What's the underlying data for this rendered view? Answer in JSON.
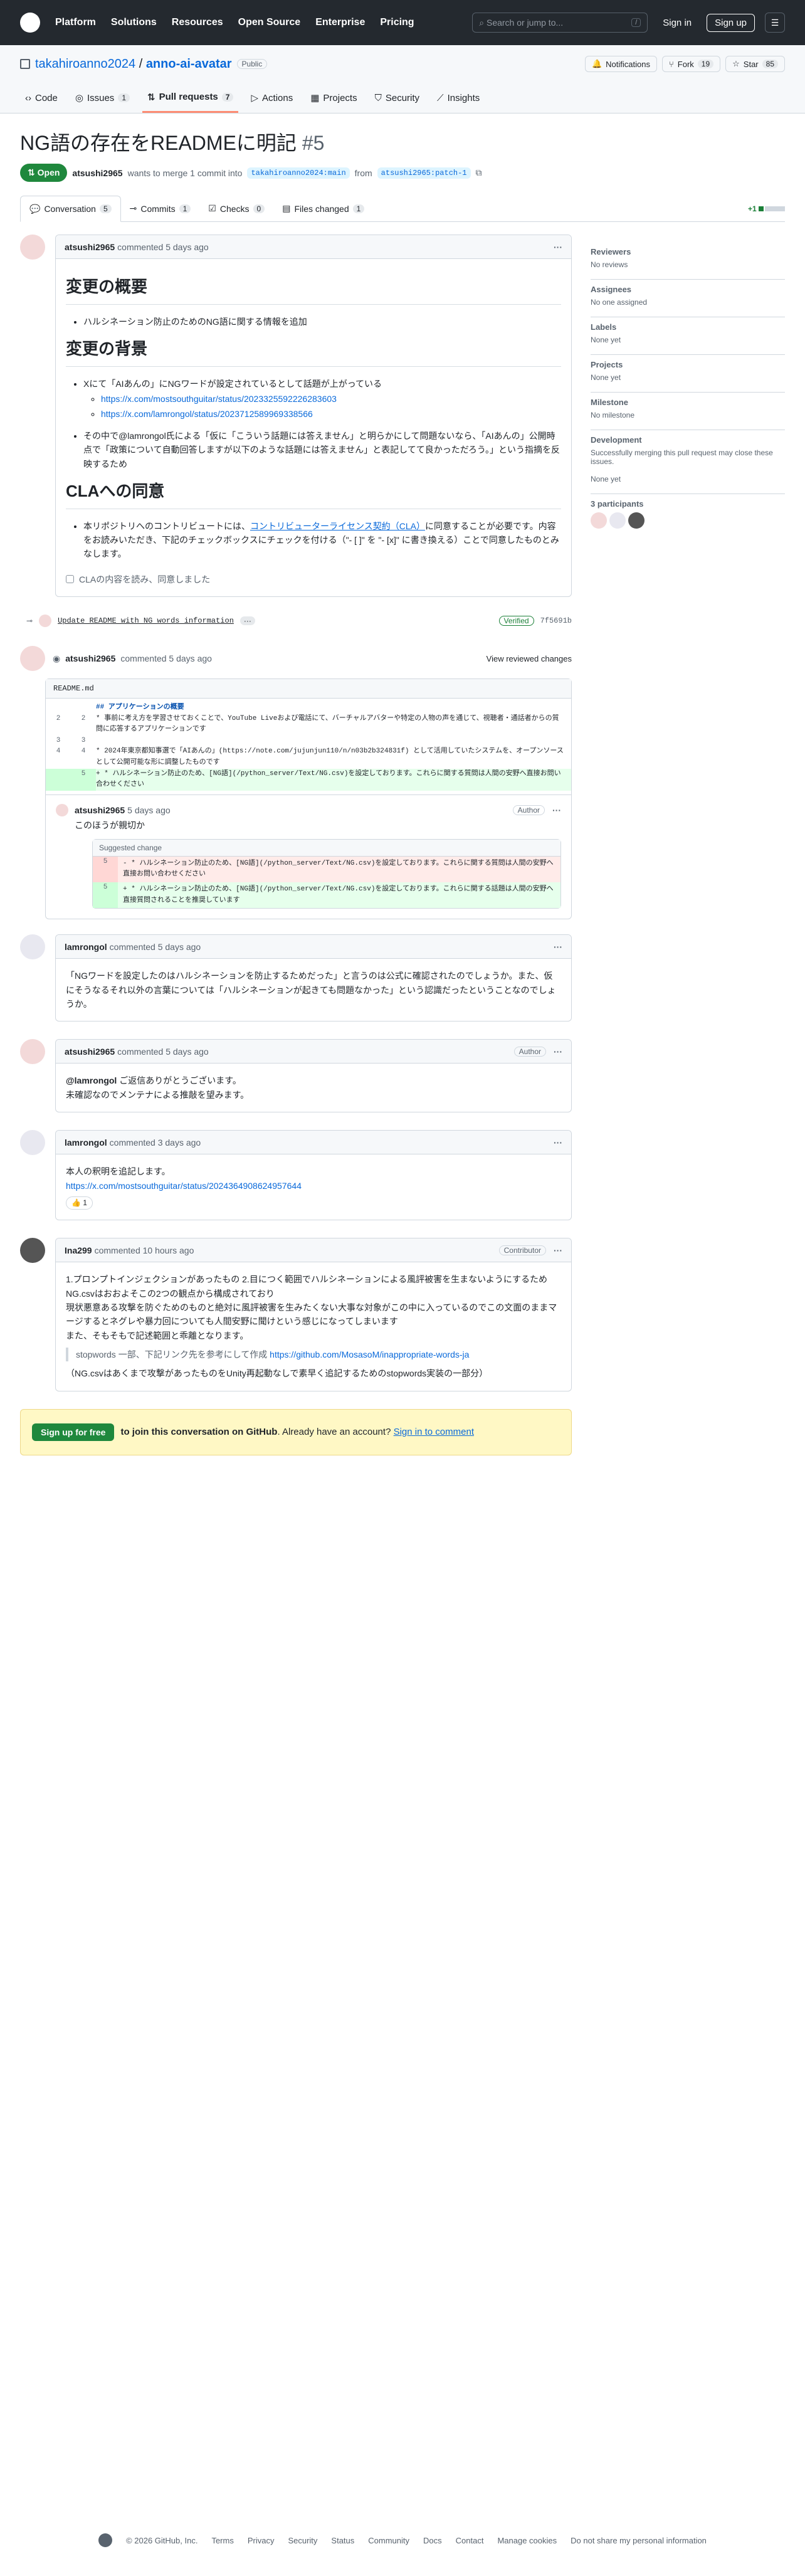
{
  "header": {
    "nav": [
      "Platform",
      "Solutions",
      "Resources",
      "Open Source",
      "Enterprise",
      "Pricing"
    ],
    "search_placeholder": "Search or jump to...",
    "search_key": "/",
    "signin": "Sign in",
    "signup": "Sign up"
  },
  "repo": {
    "owner": "takahiroanno2024",
    "name": "anno-ai-avatar",
    "visibility": "Public",
    "notifications": "Notifications",
    "fork": "Fork",
    "fork_count": "19",
    "star": "Star",
    "star_count": "85",
    "tabs": [
      {
        "label": "Code",
        "count": ""
      },
      {
        "label": "Issues",
        "count": "1"
      },
      {
        "label": "Pull requests",
        "count": "7"
      },
      {
        "label": "Actions",
        "count": ""
      },
      {
        "label": "Projects",
        "count": ""
      },
      {
        "label": "Security",
        "count": ""
      },
      {
        "label": "Insights",
        "count": ""
      }
    ]
  },
  "pr": {
    "title": "NG語の存在をREADMEに明記",
    "number": "#5",
    "state": "Open",
    "author": "atsushi2965",
    "wants": "wants to merge 1 commit into",
    "base": "takahiroanno2024:main",
    "from": "from",
    "head": "atsushi2965:patch-1",
    "tabs": [
      {
        "label": "Conversation",
        "count": "5"
      },
      {
        "label": "Commits",
        "count": "1"
      },
      {
        "label": "Checks",
        "count": "0"
      },
      {
        "label": "Files changed",
        "count": "1"
      }
    ],
    "diffstat": "+1"
  },
  "sidebar": [
    {
      "h": "Reviewers",
      "v": "No reviews"
    },
    {
      "h": "Assignees",
      "v": "No one assigned"
    },
    {
      "h": "Labels",
      "v": "None yet"
    },
    {
      "h": "Projects",
      "v": "None yet"
    },
    {
      "h": "Milestone",
      "v": "No milestone"
    },
    {
      "h": "Development",
      "v": "Successfully merging this pull request may close these issues."
    },
    {
      "h": "",
      "v": "None yet"
    },
    {
      "h": "3 participants",
      "v": ""
    }
  ],
  "c1": {
    "author": "atsushi2965",
    "when": "commented 5 days ago",
    "h_summary": "変更の概要",
    "summary_item": "ハルシネーション防止のためのNG語に関する情報を追加",
    "h_bg": "変更の背景",
    "bg1": "Xにて「AIあんの」にNGワードが設定されているとして話題が上がっている",
    "link1": "https://x.com/mostsouthguitar/status/2023325592226283603",
    "link2": "https://x.com/lamrongol/status/2023712589969338566",
    "bg2": "その中で@lamrongol氏による「仮に「こういう話題には答えません」と明らかにして問題ないなら、「AIあんの」公開時点で「政策について自動回答しますが以下のような話題には答えません」と表記してて良かっただろう。」という指摘を反映するため",
    "h_cla": "CLAへの同意",
    "cla1": "本リポジトリへのコントリビュートには、",
    "cla_link": "コントリビューターライセンス契約（CLA）",
    "cla2": "に同意することが必要です。内容をお読みいただき、下記のチェックボックスにチェックを付ける（\"- [ ]\" を \"- [x]\" に書き換える）ことで同意したものとみなします。",
    "check": "CLAの内容を読み、同意しました"
  },
  "commit": {
    "msg": "Update README with NG words information",
    "verified": "Verified",
    "sha": "7f5691b"
  },
  "review": {
    "author": "atsushi2965",
    "when": "commented 5 days ago",
    "view": "View reviewed changes",
    "file": "README.md",
    "lines": [
      [
        "",
        "",
        "## アプリケーションの概要"
      ],
      [
        "2",
        "2",
        "* 事前に考え方を学習させておくことで、YouTube Liveおよび電話にて、バーチャルアバターや特定の人物の声を通じて、視聴者・通話者からの質問に応答するアプリケーションです"
      ],
      [
        "3",
        "3",
        ""
      ],
      [
        "4",
        "4",
        "* 2024年東京都知事選で「AIあんの」(https://note.com/jujunjun110/n/n03b2b324831f) として活用していたシステムを、オープンソースとして公開可能な形に調整したものです"
      ],
      [
        "",
        "5",
        "+ * ハルシネーション防止のため、[NG語](/python_server/Text/NG.csv)を設定しております。これらに関する質問は人間の安野へ直接お問い合わせください"
      ]
    ],
    "reply_author": "atsushi2965",
    "reply_when": "5 days ago",
    "role": "Author",
    "reply": "このほうが親切か",
    "sug_title": "Suggested change",
    "del": "- * ハルシネーション防止のため、[NG語](/python_server/Text/NG.csv)を設定しております。これらに関する質問は人間の安野へ直接お問い合わせください",
    "add": "+ * ハルシネーション防止のため、[NG語](/python_server/Text/NG.csv)を設定しております。これらに関する話題は人間の安野へ直接質問されることを推奨しています"
  },
  "c2": {
    "author": "lamrongol",
    "when": "commented 5 days ago",
    "text": "「NGワードを設定したのはハルシネーションを防止するためだった」と言うのは公式に確認されたのでしょうか。また、仮にそうなるそれ以外の言葉については「ハルシネーションが起きても問題なかった」という認識だったということなのでしょうか。"
  },
  "c3": {
    "author": "atsushi2965",
    "when": "commented 5 days ago",
    "role": "Author",
    "mention": "@lamrongol",
    "t1": " ご返信ありがとうございます。",
    "t2": "未確認なのでメンテナによる推敲を望みます。"
  },
  "c4": {
    "author": "lamrongol",
    "when": "commented 3 days ago",
    "t1": "本人の釈明を追記します。",
    "link": "https://x.com/mostsouthguitar/status/2024364908624957644",
    "react": "👍 1"
  },
  "c5": {
    "author": "Ina299",
    "when": "commented 10 hours ago",
    "role": "Contributor",
    "t1": "1.プロンプトインジェクションがあったもの 2.目につく範囲でハルシネーションによる風評被害を生まないようにするためNG.csvはおおよそこの2つの観点から構成されており",
    "t2": "現状悪意ある攻撃を防ぐためのものと絶対に風評被害を生みたくない大事な対象がこの中に入っているのでこの文面のままマージするとネグレや暴力回についても人間安野に聞けという感じになってしまいます",
    "t3": "また、そもそもで記述範囲と乖離となります。",
    "q1": "stopwords 一部、下記リンク先を参考にして作成 ",
    "qlink": "https://github.com/MosasoM/inappropriate-words-ja",
    "t4": "（NG.csvはあくまで攻撃があったものをUnity再起動なしで素早く追記するためのstopwords実装の一部分）"
  },
  "banner": {
    "btn": "Sign up for free",
    "t1": "to join this conversation on GitHub",
    "t2": ". Already have an account?",
    "link": "Sign in to comment"
  },
  "footer": [
    "© 2026 GitHub, Inc.",
    "Terms",
    "Privacy",
    "Security",
    "Status",
    "Community",
    "Docs",
    "Contact",
    "Manage cookies",
    "Do not share my personal information"
  ]
}
